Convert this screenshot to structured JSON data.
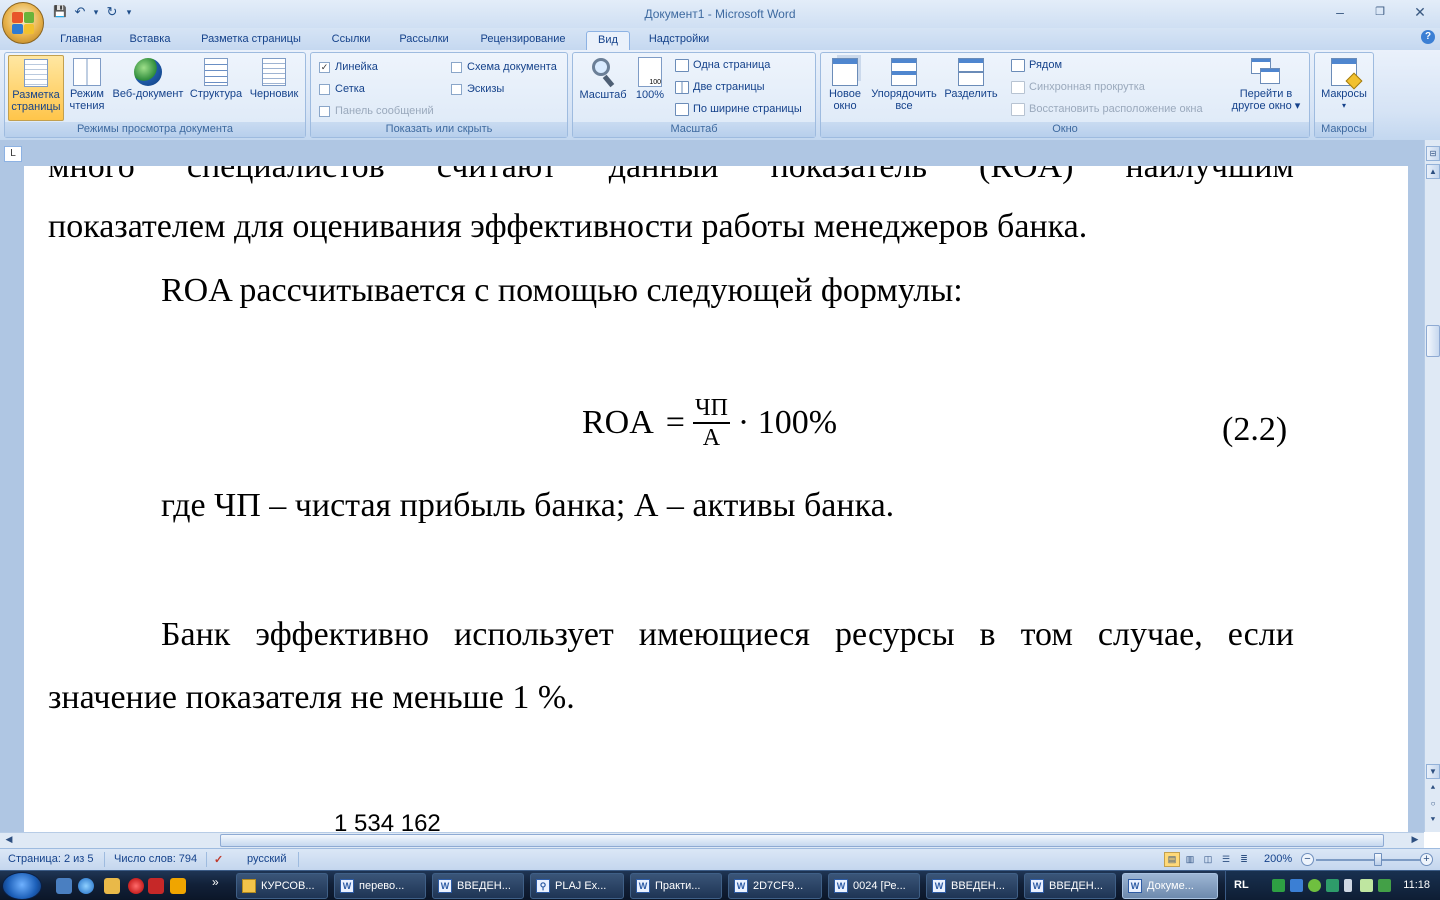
{
  "window": {
    "title": "Документ1 - Microsoft Word",
    "minimize": "‒",
    "maximize": "❐",
    "close": "✕"
  },
  "qat": {
    "save_icon": "💾",
    "undo_icon": "↶",
    "undo_dropdown": "▾",
    "redo_icon": "↻",
    "customize": "▾"
  },
  "tabs": [
    "Главная",
    "Вставка",
    "Разметка страницы",
    "Ссылки",
    "Рассылки",
    "Рецензирование",
    "Вид",
    "Надстройки"
  ],
  "active_tab": "Вид",
  "help": "?",
  "ribbon": {
    "views": {
      "label": "Режимы просмотра документа",
      "buttons": [
        {
          "l1": "Разметка",
          "l2": "страницы"
        },
        {
          "l1": "Режим",
          "l2": "чтения"
        },
        {
          "l1": "Веб-документ",
          "l2": ""
        },
        {
          "l1": "Структура",
          "l2": ""
        },
        {
          "l1": "Черновик",
          "l2": ""
        }
      ]
    },
    "show": {
      "label": "Показать или скрыть",
      "ruler": "Линейка",
      "grid": "Сетка",
      "messages": "Панель сообщений",
      "docmap": "Схема документа",
      "thumbs": "Эскизы",
      "check": "✓"
    },
    "zoom": {
      "label": "Масштаб",
      "zoom_btn": "Масштаб",
      "hundred": "100%",
      "hundred_icon_text": "100",
      "one_page": "Одна страница",
      "two_pages": "Две страницы",
      "page_width": "По ширине страницы"
    },
    "window": {
      "label": "Окно",
      "new_l1": "Новое",
      "new_l2": "окно",
      "arrange_l1": "Упорядочить",
      "arrange_l2": "все",
      "split": "Разделить",
      "side": "Рядом",
      "sync": "Синхронная прокрутка",
      "reset": "Восстановить расположение окна",
      "switch_l1": "Перейти в",
      "switch_l2": "другое окно ▾"
    },
    "macros": {
      "label": "Макросы",
      "btn": "Макросы",
      "arrow": "▾"
    }
  },
  "ruler_corner": "L",
  "document": {
    "line1_words": [
      "много",
      "специалистов",
      "считают",
      "данный",
      "показатель",
      "(ROA)",
      "наилучшим"
    ],
    "line2": "показателем для оценивания эффективности работы менеджеров банка.",
    "line3": "ROA рассчитывается с помощью следующей формулы:",
    "formula": {
      "lhs": "ROA",
      "eq": "=",
      "num": "ЧП",
      "den": "А",
      "rhs": "· 100%"
    },
    "eq_number": "(2.2)",
    "line4": "где ЧП – чистая прибыль банка; А – активы банка.",
    "line5_words": [
      "Банк",
      "эффективно",
      "использует",
      "имеющиеся",
      "ресурсы",
      "в",
      "том",
      "случае,",
      "если"
    ],
    "line6": "значение показателя не меньше 1 %.",
    "line7_partial": "1 534 162"
  },
  "scroll": {
    "up": "▲",
    "down": "▼",
    "prev": "⯅",
    "select": "○",
    "next": "⯆",
    "split": "⊟",
    "left": "◀",
    "right": "▶"
  },
  "status": {
    "page": "Страница: 2 из 5",
    "words": "Число слов: 794",
    "lang": "русский",
    "zoom": "200%",
    "minus": "−",
    "plus": "+"
  },
  "taskbar": {
    "tasks": [
      "КУРСОВ...",
      "перево...",
      "ВВЕДЕН...",
      "PLAJ Ex...",
      "Практи...",
      "2D7CF9...",
      "0024 [Ре...",
      "ВВЕДЕН...",
      "ВВЕДЕН...",
      "Докуме..."
    ],
    "active_index": 9,
    "more": "»",
    "lang": "RL",
    "time": "11:18"
  }
}
